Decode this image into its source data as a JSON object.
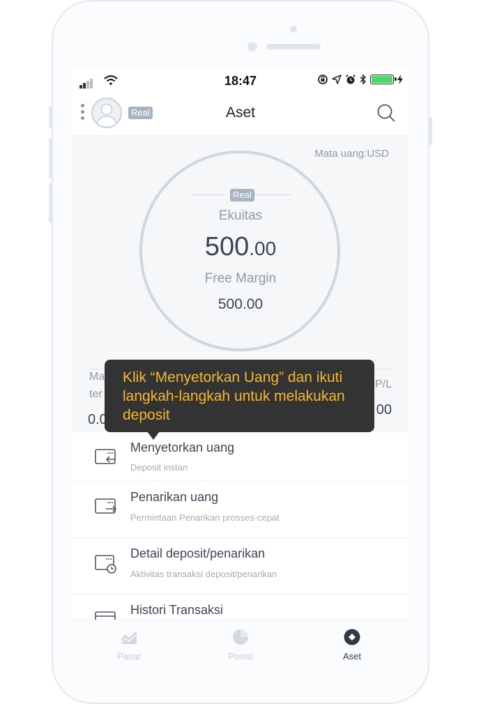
{
  "status_bar": {
    "time": "18:47"
  },
  "header": {
    "account_badge": "Real",
    "title": "Aset"
  },
  "assets": {
    "currency_label": "Mata uang:USD",
    "badge": "Real",
    "equity_label": "Ekuitas",
    "equity_int": "500",
    "equity_dec": ".00",
    "free_margin_label": "Free Margin",
    "free_margin_value": "500.00",
    "left_stat_label_line1": "Ma",
    "left_stat_label_line2": "ter",
    "left_stat_value": "0.0",
    "right_stat_label": "P/L",
    "right_stat_value": "00"
  },
  "tooltip": {
    "text": "Klik “Menyetorkan Uang” dan ikuti langkah-langkah untuk melakukan deposit"
  },
  "menu": {
    "items": [
      {
        "title": "Menyetorkan uang",
        "subtitle": "Deposit instan",
        "icon": "deposit-card-icon"
      },
      {
        "title": "Penarikan uang",
        "subtitle": "Permintaan Penarikan prosses-cepat",
        "icon": "withdraw-card-icon"
      },
      {
        "title": "Detail deposit/penarikan",
        "subtitle": "Aktivitas transaksi deposit/penarikan",
        "icon": "card-history-icon"
      },
      {
        "title": "Histori Transaksi",
        "subtitle": "",
        "icon": "transaction-history-icon"
      }
    ]
  },
  "tabbar": {
    "tabs": [
      {
        "label": "Pasar",
        "icon": "market-chart-icon",
        "active": false
      },
      {
        "label": "Posisi",
        "icon": "pie-chart-icon",
        "active": false
      },
      {
        "label": "Aset",
        "icon": "asset-diamond-icon",
        "active": true
      }
    ]
  },
  "colors": {
    "tooltip_bg": "#333333",
    "tooltip_text": "#f5b731",
    "battery": "#4cd964",
    "primary_text": "#3b4654",
    "muted_text": "#8f9aa5"
  }
}
